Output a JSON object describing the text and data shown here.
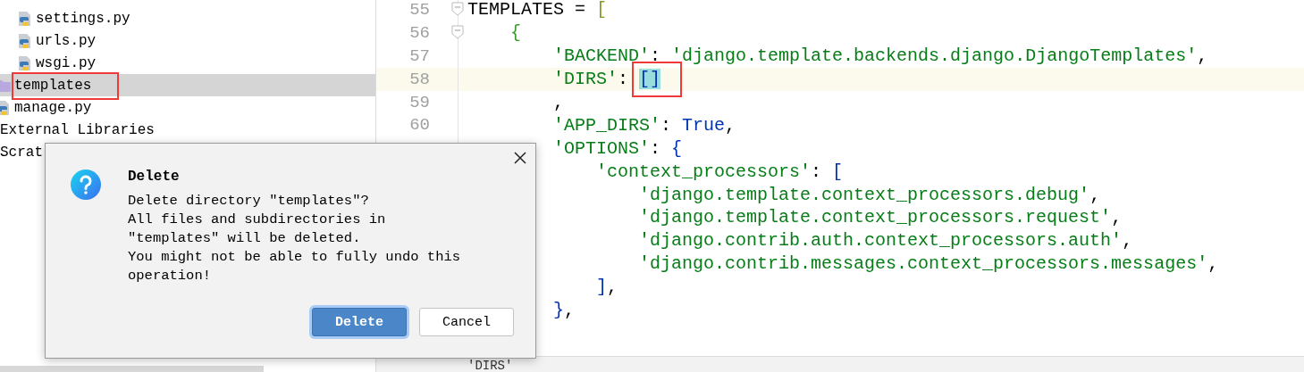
{
  "project_tree": {
    "package_files": [
      {
        "label": "settings.py",
        "kind": "python",
        "selected": false,
        "annotated": false
      },
      {
        "label": "urls.py",
        "kind": "python",
        "selected": false,
        "annotated": false
      },
      {
        "label": "wsgi.py",
        "kind": "python",
        "selected": false,
        "annotated": false
      }
    ],
    "items": [
      {
        "label": "templates",
        "kind": "folder",
        "selected": true,
        "annotated": true
      },
      {
        "label": "manage.py",
        "kind": "python",
        "selected": false,
        "annotated": false
      },
      {
        "label": "External Libraries",
        "kind": "plain",
        "selected": false,
        "annotated": false
      },
      {
        "label": "Scrat",
        "kind": "plain",
        "selected": false,
        "annotated": false
      }
    ]
  },
  "editor": {
    "lines": [
      {
        "number": "55",
        "fold": true,
        "current": false,
        "tokens": [
          {
            "t": "TEMPLATES = ",
            "kind": "name"
          },
          {
            "t": "[",
            "kind": "bracket-outer"
          }
        ],
        "children": [
          {
            "number": "56",
            "fold": true,
            "current": false,
            "tokens": [
              {
                "t": "{",
                "kind": "bracket-inner"
              }
            ],
            "children": [
              {
                "number": "57",
                "fold": false,
                "current": false,
                "tokens": [
                  {
                    "t": "'BACKEND'",
                    "kind": "string"
                  },
                  {
                    "t": ": ",
                    "kind": "name"
                  },
                  {
                    "t": "'django.template.backends.django.DjangoTemplates'",
                    "kind": "string"
                  },
                  {
                    "t": ",",
                    "kind": "name"
                  }
                ]
              },
              {
                "number": "58",
                "fold": false,
                "current": true,
                "tokens": [
                  {
                    "t": "'DIRS'",
                    "kind": "string"
                  },
                  {
                    "t": ": ",
                    "kind": "name"
                  },
                  {
                    "t": "[]",
                    "kind": "bracket",
                    "matched": true,
                    "annotated": true
                  }
                ]
              },
              {
                "number": "59",
                "fold": false,
                "current": false,
                "tokens": [
                  {
                    "t": ",",
                    "kind": "name"
                  }
                ]
              },
              {
                "number": "60",
                "fold": false,
                "current": false,
                "tokens": [
                  {
                    "t": "'APP_DIRS'",
                    "kind": "string"
                  },
                  {
                    "t": ": ",
                    "kind": "name"
                  },
                  {
                    "t": "True",
                    "kind": "keyword"
                  },
                  {
                    "t": ",",
                    "kind": "name"
                  }
                ]
              },
              {
                "fold": false,
                "current": false,
                "tokens": [
                  {
                    "t": "'OPTIONS'",
                    "kind": "string"
                  },
                  {
                    "t": ": ",
                    "kind": "name"
                  },
                  {
                    "t": "{",
                    "kind": "bracket"
                  }
                ],
                "children": [
                  {
                    "fold": false,
                    "current": false,
                    "tokens": [
                      {
                        "t": "'context_processors'",
                        "kind": "string"
                      },
                      {
                        "t": ": ",
                        "kind": "name"
                      },
                      {
                        "t": "[",
                        "kind": "bracket"
                      }
                    ],
                    "children": [
                      {
                        "fold": false,
                        "current": false,
                        "tokens": [
                          {
                            "t": "'django.template.context_processors.debug'",
                            "kind": "string"
                          },
                          {
                            "t": ",",
                            "kind": "name"
                          }
                        ]
                      },
                      {
                        "fold": false,
                        "current": false,
                        "tokens": [
                          {
                            "t": "'django.template.context_processors.request'",
                            "kind": "string"
                          },
                          {
                            "t": ",",
                            "kind": "name"
                          }
                        ]
                      },
                      {
                        "fold": false,
                        "current": false,
                        "tokens": [
                          {
                            "t": "'django.contrib.auth.context_processors.auth'",
                            "kind": "string"
                          },
                          {
                            "t": ",",
                            "kind": "name"
                          }
                        ]
                      },
                      {
                        "fold": false,
                        "current": false,
                        "tokens": [
                          {
                            "t": "'django.contrib.messages.context_processors.messages'",
                            "kind": "string"
                          },
                          {
                            "t": ",",
                            "kind": "name"
                          }
                        ]
                      }
                    ]
                  },
                  {
                    "fold": false,
                    "current": false,
                    "tokens": [
                      {
                        "t": "]",
                        "kind": "bracket"
                      },
                      {
                        "t": ",",
                        "kind": "name"
                      }
                    ]
                  }
                ]
              },
              {
                "fold": false,
                "current": false,
                "tokens": [
                  {
                    "t": "}",
                    "kind": "bracket"
                  },
                  {
                    "t": ",",
                    "kind": "name"
                  }
                ]
              }
            ]
          }
        ]
      }
    ],
    "breadcrumb": "'DIRS'"
  },
  "dialog": {
    "title": "Delete",
    "message": "Delete directory \"templates\"?\nAll files and subdirectories in\n\"templates\" will be deleted.\nYou might not be able to fully undo this\noperation!",
    "buttons": [
      {
        "label": "Delete",
        "kind": "primary"
      },
      {
        "label": "Cancel",
        "kind": "secondary"
      }
    ]
  }
}
